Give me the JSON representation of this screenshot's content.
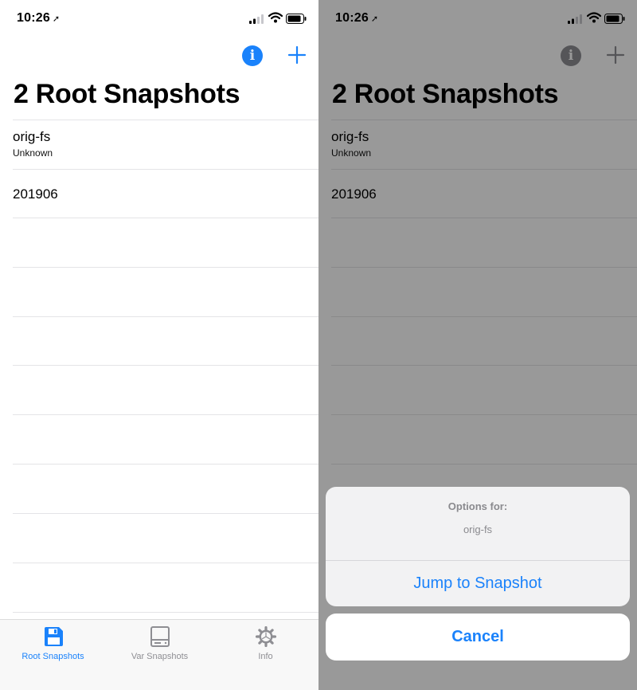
{
  "colors": {
    "accent": "#1a82fb",
    "separator": "#e4e4e7",
    "tabbar_bg": "#f8f8f8",
    "inactive": "#8e8e93"
  },
  "left": {
    "status": {
      "time": "10:26",
      "location_icon": "location-arrow-icon"
    },
    "nav": {
      "title": "2 Root Snapshots",
      "info_icon": "info-icon",
      "add_icon": "plus-icon"
    },
    "rows": [
      {
        "title": "orig-fs",
        "subtitle": "Unknown"
      },
      {
        "title": "201906",
        "subtitle": ""
      }
    ],
    "tabs": [
      {
        "label": "Root Snapshots",
        "icon": "floppy-disk-icon",
        "active": true
      },
      {
        "label": "Var Snapshots",
        "icon": "drive-icon",
        "active": false
      },
      {
        "label": "Info",
        "icon": "gear-icon",
        "active": false
      }
    ]
  },
  "right": {
    "status": {
      "time": "10:26"
    },
    "nav": {
      "title": "2 Root Snapshots"
    },
    "rows": [
      {
        "title": "orig-fs",
        "subtitle": "Unknown"
      },
      {
        "title": "201906",
        "subtitle": ""
      }
    ],
    "action_sheet": {
      "title": "Options for:",
      "message": "orig-fs",
      "action_label": "Jump to Snapshot",
      "cancel_label": "Cancel"
    }
  }
}
